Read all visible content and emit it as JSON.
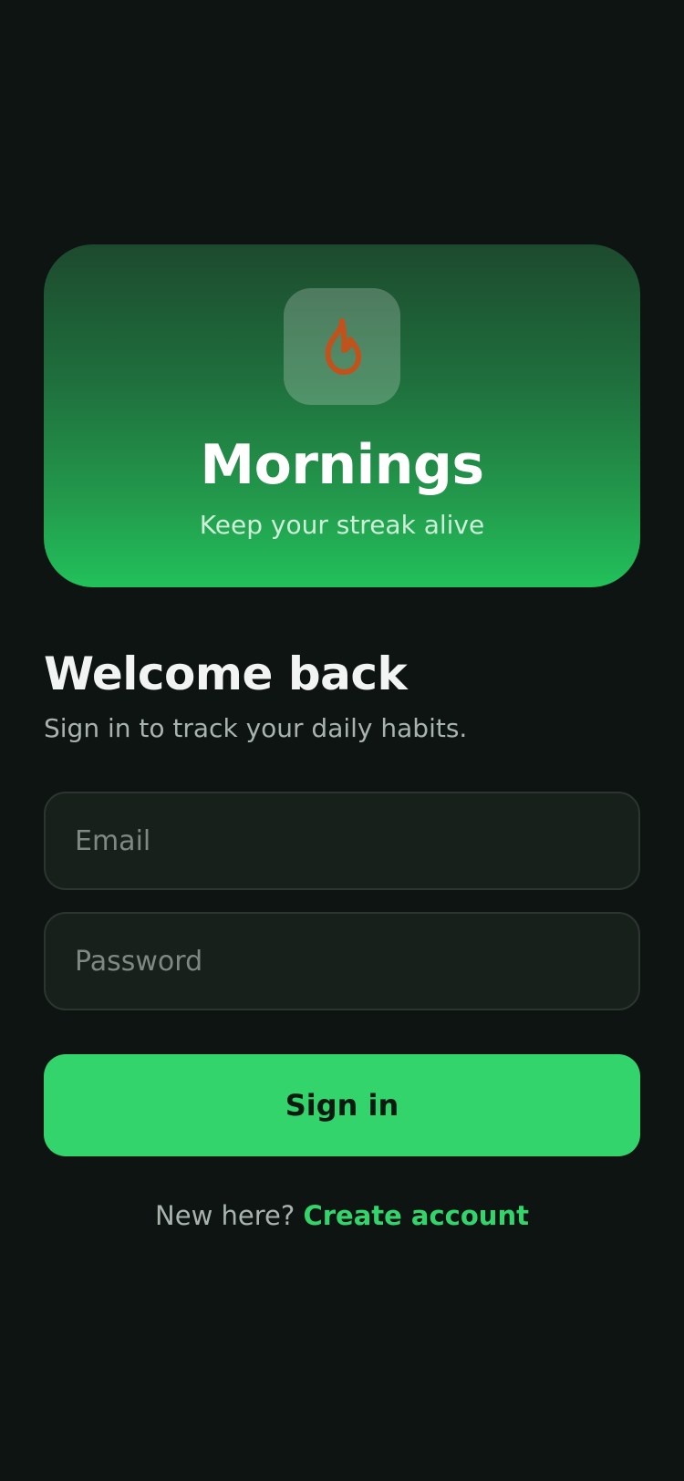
{
  "colors": {
    "background": "#0d1411",
    "accent": "#34d46d",
    "hero_top": "#1d4a2e",
    "hero_bottom": "#22c15b",
    "flame": "#c2521b"
  },
  "hero": {
    "icon": "flame-icon",
    "title": "Mornings",
    "subtitle": "Keep your streak alive"
  },
  "welcome": {
    "title": "Welcome back",
    "subtitle": "Sign in to track your daily habits."
  },
  "form": {
    "email": {
      "value": "",
      "placeholder": "Email"
    },
    "password": {
      "value": "",
      "placeholder": "Password"
    },
    "submit_label": "Sign in"
  },
  "footer": {
    "prompt": "New here?",
    "link_label": "Create account"
  }
}
